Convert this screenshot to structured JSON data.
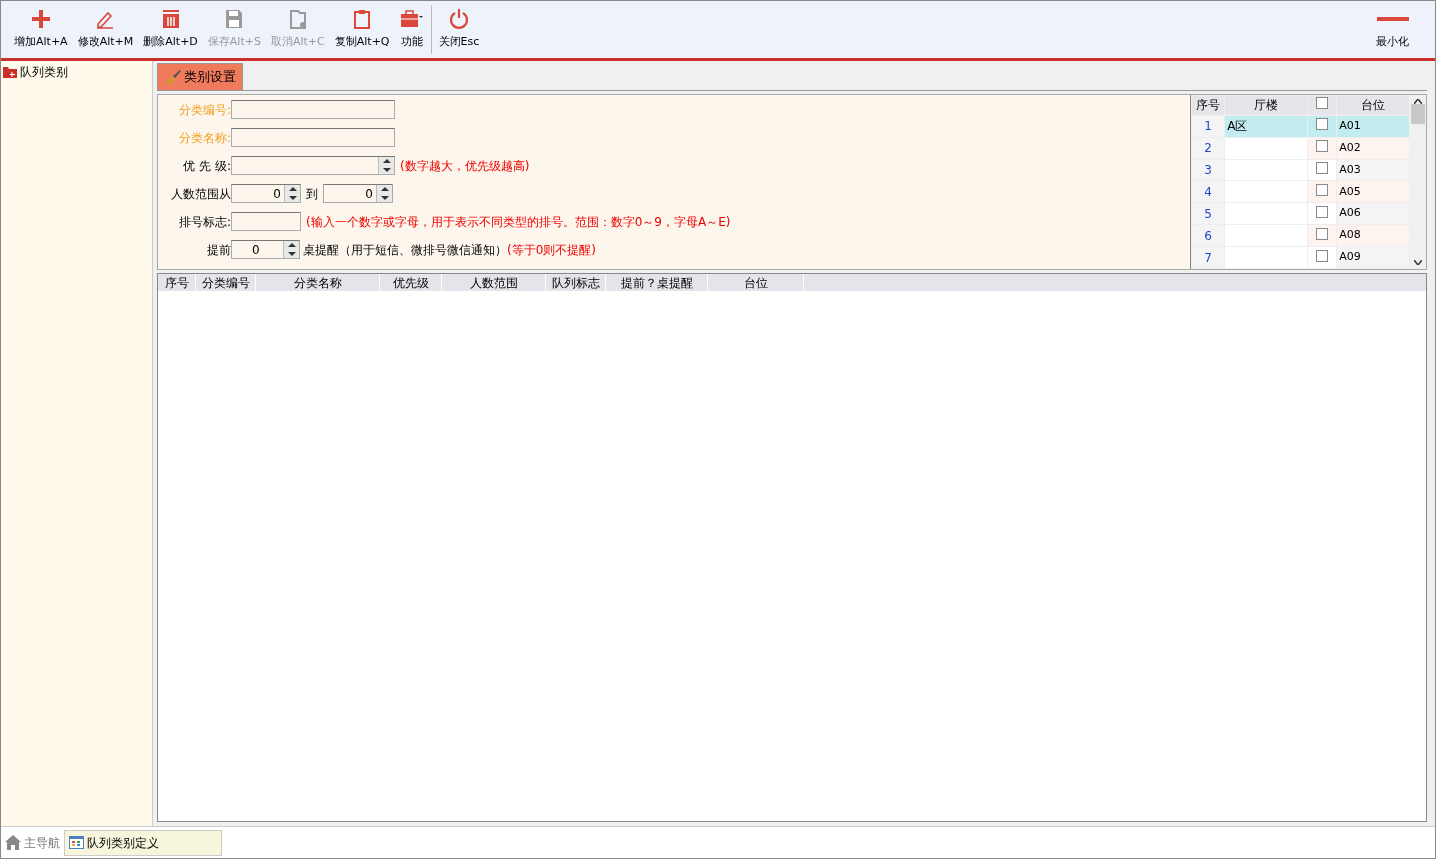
{
  "toolbar": {
    "buttons": [
      {
        "label": "增加Alt+A",
        "disabled": false
      },
      {
        "label": "修改Alt+M",
        "disabled": false
      },
      {
        "label": "删除Alt+D",
        "disabled": false
      },
      {
        "label": "保存Alt+S",
        "disabled": true
      },
      {
        "label": "取消Alt+C",
        "disabled": true
      },
      {
        "label": "复制Alt+Q",
        "disabled": false
      },
      {
        "label": "功能",
        "disabled": false
      },
      {
        "label": "关闭Esc",
        "disabled": false
      }
    ],
    "minimize": {
      "label": "最小化"
    }
  },
  "sidebar": {
    "items": [
      {
        "label": "队列类别"
      }
    ]
  },
  "tabs": [
    {
      "label": "类别设置",
      "selected": true
    }
  ],
  "form": {
    "rows": [
      {
        "kind": "text",
        "label": "分类编号:",
        "required": true
      },
      {
        "kind": "text",
        "label": "分类名称:",
        "required": true
      },
      {
        "kind": "spin",
        "label": "优 先 级:",
        "required": false,
        "hint": "(数字越大，优先级越高)"
      },
      {
        "kind": "range",
        "label": "人数范围从",
        "required": false,
        "from": "0",
        "to_label": "到",
        "to": "0"
      },
      {
        "kind": "short",
        "label": "排号标志:",
        "required": false,
        "hint": "(输入一个数字或字母，用于表示不同类型的排号。范围：数字0～9，字母A～E)"
      },
      {
        "kind": "advance",
        "label": "提前",
        "required": false,
        "value": "0",
        "suffix": "桌提醒（用于短信、微排号微信通知）",
        "hint": "(等于0则不提醒)"
      }
    ]
  },
  "station_grid": {
    "columns": [
      "序号",
      "厅楼",
      "台位"
    ],
    "header_checked": false,
    "rows": [
      {
        "index": "1",
        "hall": "A区",
        "checked": false,
        "station": "A01",
        "selected": true
      },
      {
        "index": "2",
        "checked": false,
        "station": "A02",
        "selected": false
      },
      {
        "index": "3",
        "checked": false,
        "station": "A03",
        "selected": false
      },
      {
        "index": "4",
        "checked": false,
        "station": "A05",
        "selected": false
      },
      {
        "index": "5",
        "checked": false,
        "station": "A06",
        "selected": false
      },
      {
        "index": "6",
        "checked": false,
        "station": "A08",
        "selected": false
      },
      {
        "index": "7",
        "checked": false,
        "station": "A09",
        "selected": false
      }
    ]
  },
  "table": {
    "columns": [
      "序号",
      "分类编号",
      "分类名称",
      "优先级",
      "人数范围",
      "队列标志",
      "提前？桌提醒",
      "台位"
    ]
  },
  "bottom_tabs": [
    {
      "label": "主导航",
      "kind": "home",
      "selected": false
    },
    {
      "label": "队列类别定义",
      "kind": "page",
      "selected": true
    }
  ]
}
